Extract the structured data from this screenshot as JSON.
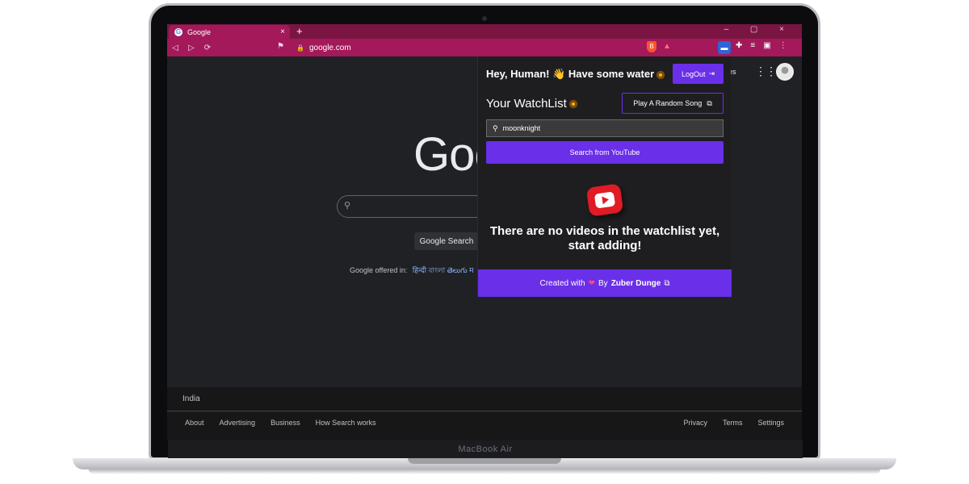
{
  "device": {
    "label": "MacBook Air"
  },
  "browser": {
    "tab_title": "Google",
    "tab_close": "×",
    "new_tab": "+",
    "window_controls": "– ▢ ×",
    "url": "google.com",
    "nav": {
      "back": "◁",
      "forward": "▷",
      "reload": "⟳"
    }
  },
  "google": {
    "logo_text": "Goo",
    "top_right_text": "ges",
    "search_button": "Google Search",
    "offered_label": "Google offered in:",
    "languages": "हिन्दी বাংলা తెలుగు म",
    "country": "India",
    "footer_left": [
      "About",
      "Advertising",
      "Business",
      "How Search works"
    ],
    "footer_right": [
      "Privacy",
      "Terms",
      "Settings"
    ]
  },
  "popup": {
    "greeting": "Hey, Human! 👋 Have some water",
    "logout_label": "LogOut",
    "watchlist_title": "Your WatchList",
    "random_song_label": "Play A Random Song",
    "search_value": "moonknight",
    "search_button_label": "Search from YouTube",
    "empty_line1": "There are no videos in the watchlist yet,",
    "empty_line2": "start adding!",
    "credit_prefix": "Created with",
    "credit_by": "By",
    "credit_author": "Zuber Dunge"
  },
  "colors": {
    "accent_purple": "#6a2fe8",
    "browser_pink": "#a3195a",
    "youtube_red": "#e01b24"
  }
}
